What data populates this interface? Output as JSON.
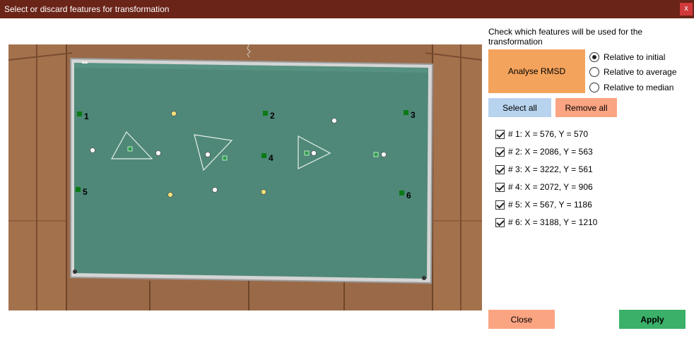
{
  "window": {
    "title": "Select or discard features for transformation",
    "close_label": "x"
  },
  "panel": {
    "heading": "Check which features will be used for the transformation",
    "analyse_label": "Analyse RMSD",
    "select_all_label": "Select all",
    "remove_all_label": "Remove all",
    "close_label": "Close",
    "apply_label": "Apply"
  },
  "options": [
    {
      "label": "Relative to initial",
      "checked": true
    },
    {
      "label": "Relative to average",
      "checked": false
    },
    {
      "label": "Relative to median",
      "checked": false
    }
  ],
  "features": [
    {
      "label": "# 1: X = 576, Y = 570",
      "checked": true
    },
    {
      "label": "# 2: X = 2086, Y = 563",
      "checked": true
    },
    {
      "label": "# 3: X = 3222, Y = 561",
      "checked": true
    },
    {
      "label": "# 4: X = 2072, Y = 906",
      "checked": true
    },
    {
      "label": "# 5: X = 567, Y = 1186",
      "checked": true
    },
    {
      "label": "# 6: X = 3188, Y = 1210",
      "checked": true
    }
  ],
  "image": {
    "marker_labels": [
      "1",
      "2",
      "3",
      "4",
      "5",
      "6"
    ]
  }
}
